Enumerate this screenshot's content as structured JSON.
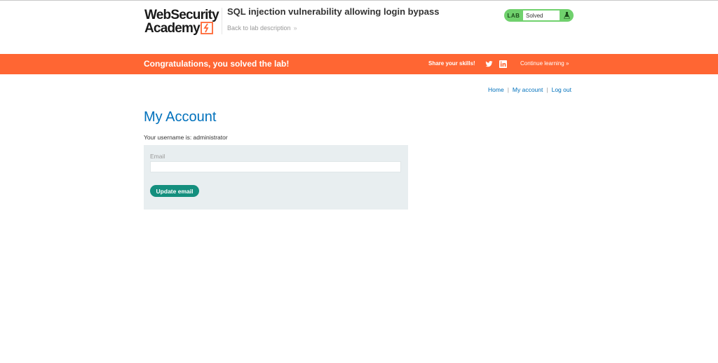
{
  "logo": {
    "line1": "WebSecurity",
    "line2": "Academy"
  },
  "header": {
    "lab_title": "SQL injection vulnerability allowing login bypass",
    "back_link": "Back to lab description",
    "lab_tag": "LAB",
    "status": "Solved",
    "status_color": "#70d16d"
  },
  "banner": {
    "message": "Congratulations, you solved the lab!",
    "share": "Share your skills!",
    "continue": "Continue learning",
    "color": "#ff6633"
  },
  "nav": {
    "home": "Home",
    "sep1": "|",
    "my_account": "My account",
    "sep2": "|",
    "logout": "Log out"
  },
  "main": {
    "title": "My Account",
    "username_line": "Your username is: administrator",
    "form": {
      "email_label": "Email",
      "email_value": "",
      "submit_label": "Update email"
    }
  },
  "colors": {
    "link": "#0071bc",
    "button": "#148f7e",
    "form_bg": "#e8eef0"
  }
}
